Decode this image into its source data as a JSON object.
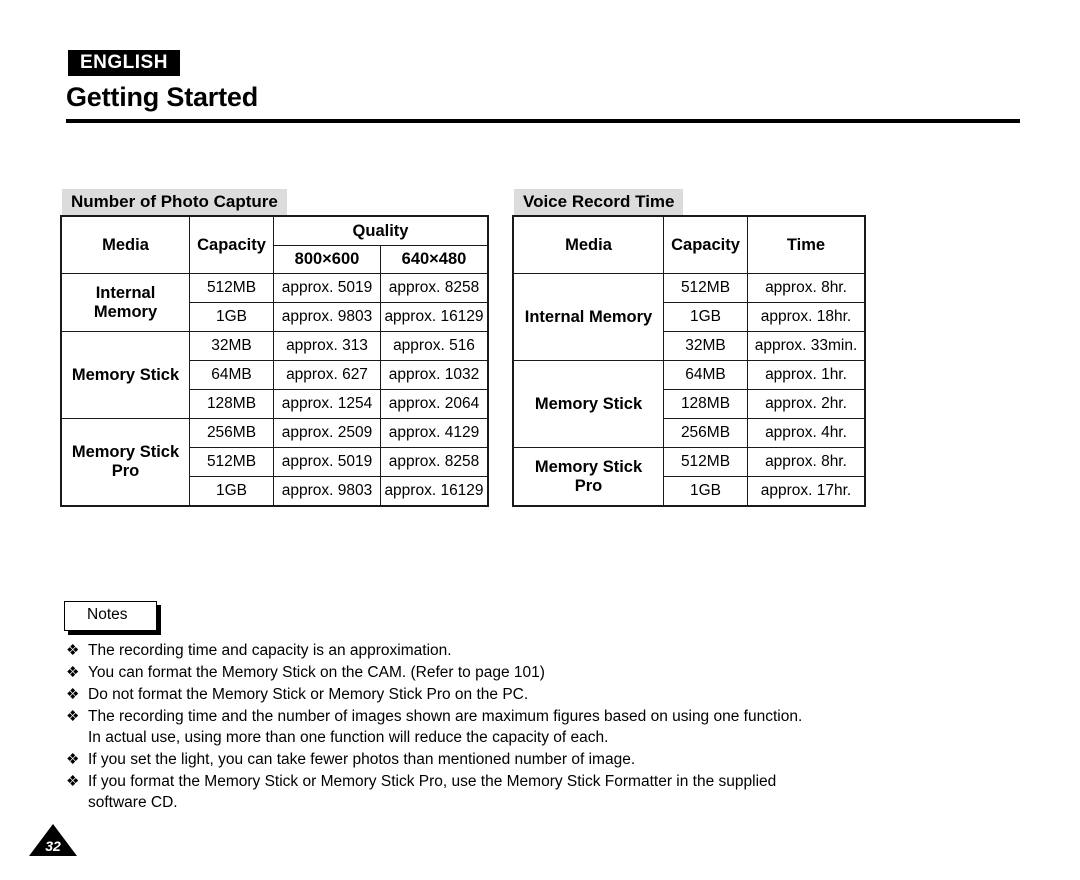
{
  "header": {
    "language_badge": "ENGLISH",
    "title": "Getting Started"
  },
  "sections": {
    "photo": {
      "caption": "Number of Photo Capture",
      "columns": {
        "media": "Media",
        "capacity": "Capacity",
        "quality": "Quality",
        "quality_sub": [
          "800×600",
          "640×480"
        ]
      },
      "groups": [
        {
          "media": "Internal Memory",
          "media_line1": "Internal",
          "media_line2": "Memory",
          "rows": [
            {
              "capacity": "512MB",
              "q800": "approx. 5019",
              "q640": "approx. 8258"
            },
            {
              "capacity": "1GB",
              "q800": "approx. 9803",
              "q640": "approx. 16129"
            }
          ]
        },
        {
          "media": "Memory Stick",
          "media_line1": "Memory Stick",
          "media_line2": "",
          "rows": [
            {
              "capacity": "32MB",
              "q800": "approx. 313",
              "q640": "approx. 516"
            },
            {
              "capacity": "64MB",
              "q800": "approx. 627",
              "q640": "approx. 1032"
            },
            {
              "capacity": "128MB",
              "q800": "approx. 1254",
              "q640": "approx. 2064"
            }
          ]
        },
        {
          "media": "Memory Stick Pro",
          "media_line1": "Memory Stick",
          "media_line2": "Pro",
          "rows": [
            {
              "capacity": "256MB",
              "q800": "approx. 2509",
              "q640": "approx. 4129"
            },
            {
              "capacity": "512MB",
              "q800": "approx. 5019",
              "q640": "approx. 8258"
            },
            {
              "capacity": "1GB",
              "q800": "approx. 9803",
              "q640": "approx. 16129"
            }
          ]
        }
      ]
    },
    "voice": {
      "caption": "Voice Record Time",
      "columns": {
        "media": "Media",
        "capacity": "Capacity",
        "time": "Time"
      },
      "groups": [
        {
          "media": "Internal Memory",
          "media_line1": "Internal Memory",
          "media_line2": "",
          "rows": [
            {
              "capacity": "512MB",
              "time": "approx. 8hr."
            },
            {
              "capacity": "1GB",
              "time": "approx. 18hr."
            },
            {
              "capacity": "32MB",
              "time": "approx. 33min."
            }
          ]
        },
        {
          "media": "Memory Stick",
          "media_line1": "Memory Stick",
          "media_line2": "",
          "rows": [
            {
              "capacity": "64MB",
              "time": "approx. 1hr."
            },
            {
              "capacity": "128MB",
              "time": "approx. 2hr."
            },
            {
              "capacity": "256MB",
              "time": "approx. 4hr."
            }
          ]
        },
        {
          "media": "Memory Stick Pro",
          "media_line1": "Memory Stick",
          "media_line2": "Pro",
          "rows": [
            {
              "capacity": "512MB",
              "time": "approx. 8hr."
            },
            {
              "capacity": "1GB",
              "time": "approx. 17hr."
            }
          ]
        }
      ]
    }
  },
  "notes": {
    "label": "Notes",
    "bullet_glyph": "❖",
    "items": [
      {
        "text": "The recording time and capacity is an approximation.",
        "cont": ""
      },
      {
        "text": "You can format the Memory Stick on the CAM. (Refer to page 101)",
        "cont": ""
      },
      {
        "text": "Do not format the Memory Stick or Memory Stick Pro on the PC.",
        "cont": ""
      },
      {
        "text": "The recording time and the number of images shown are maximum figures based on using one function.",
        "cont": "In actual use, using more than one function will reduce the capacity of each."
      },
      {
        "text": "If you set the light, you can take fewer photos than mentioned number of image.",
        "cont": ""
      },
      {
        "text": "If you format the Memory Stick or Memory Stick Pro, use the Memory Stick Formatter in the supplied",
        "cont": "software CD."
      }
    ]
  },
  "footer": {
    "page_number": "32"
  },
  "colors": {
    "caption_background": "#dcdcdc",
    "rule": "#000000",
    "badge_background": "#000000",
    "text": "#000000"
  }
}
